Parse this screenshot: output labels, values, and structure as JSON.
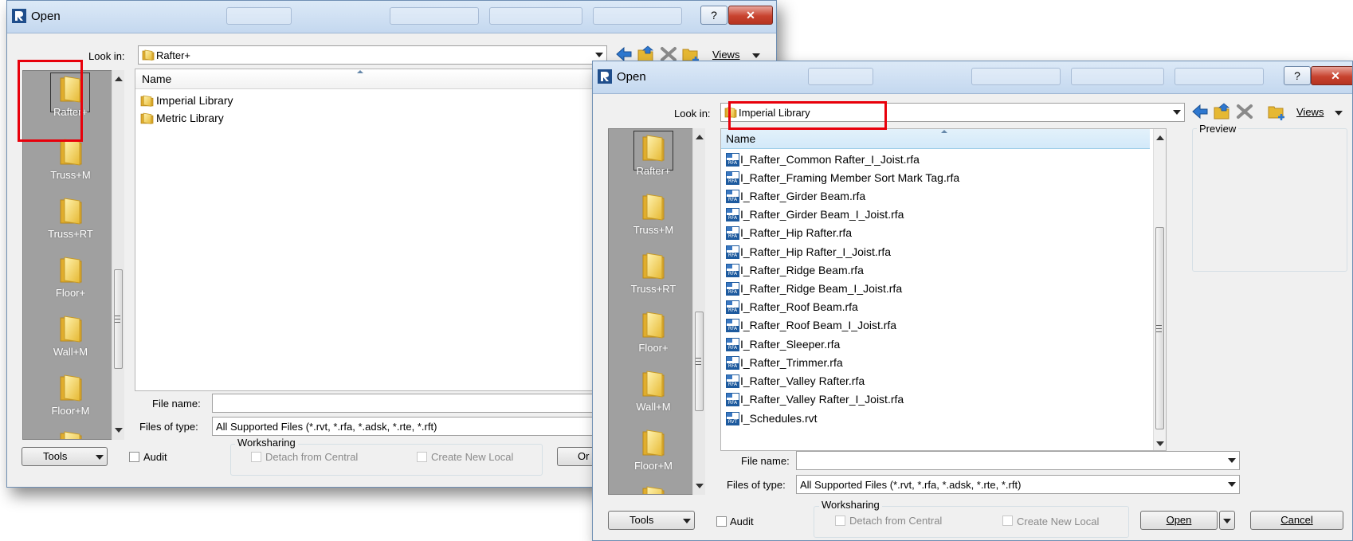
{
  "dialog1": {
    "title": "Open",
    "help_label": "?",
    "close_label": "✕",
    "look_in_label": "Look in:",
    "look_in_value": "Rafter+",
    "views_label": "Views",
    "column_name": "Name",
    "places": [
      "Rafter+",
      "Truss+M",
      "Truss+RT",
      "Floor+",
      "Wall+M",
      "Floor+M"
    ],
    "files": [
      "Imperial Library",
      "Metric Library"
    ],
    "file_name_label": "File name:",
    "file_name_value": "",
    "files_of_type_label": "Files of type:",
    "files_of_type_value": "All Supported Files  (*.rvt, *.rfa, *.adsk, *.rte, *.rft)",
    "tools_label": "Tools",
    "audit_label": "Audit",
    "worksharing_label": "Worksharing",
    "detach_label": "Detach from Central",
    "create_local_label": "Create New Local",
    "open_label_partial": "Or"
  },
  "dialog2": {
    "title": "Open",
    "help_label": "?",
    "close_label": "✕",
    "look_in_label": "Look in:",
    "look_in_value": "Imperial Library",
    "views_label": "Views",
    "column_name": "Name",
    "preview_label": "Preview",
    "places": [
      "Rafter+",
      "Truss+M",
      "Truss+RT",
      "Floor+",
      "Wall+M",
      "Floor+M"
    ],
    "files": [
      {
        "name": "I_Rafter_Common Rafter_I_Joist.rfa",
        "type": "RFA"
      },
      {
        "name": "I_Rafter_Framing Member Sort Mark Tag.rfa",
        "type": "RFA"
      },
      {
        "name": "I_Rafter_Girder Beam.rfa",
        "type": "RFA"
      },
      {
        "name": "I_Rafter_Girder Beam_I_Joist.rfa",
        "type": "RFA"
      },
      {
        "name": "I_Rafter_Hip Rafter.rfa",
        "type": "RFA"
      },
      {
        "name": "I_Rafter_Hip Rafter_I_Joist.rfa",
        "type": "RFA"
      },
      {
        "name": "I_Rafter_Ridge Beam.rfa",
        "type": "RFA"
      },
      {
        "name": "I_Rafter_Ridge Beam_I_Joist.rfa",
        "type": "RFA"
      },
      {
        "name": "I_Rafter_Roof Beam.rfa",
        "type": "RFA"
      },
      {
        "name": "I_Rafter_Roof Beam_I_Joist.rfa",
        "type": "RFA"
      },
      {
        "name": "I_Rafter_Sleeper.rfa",
        "type": "RFA"
      },
      {
        "name": "I_Rafter_Trimmer.rfa",
        "type": "RFA"
      },
      {
        "name": "I_Rafter_Valley Rafter.rfa",
        "type": "RFA"
      },
      {
        "name": "I_Rafter_Valley Rafter_I_Joist.rfa",
        "type": "RFA"
      },
      {
        "name": "I_Schedules.rvt",
        "type": "RVT"
      }
    ],
    "file_name_label": "File name:",
    "file_name_value": "",
    "files_of_type_label": "Files of type:",
    "files_of_type_value": "All Supported Files  (*.rvt, *.rfa, *.adsk, *.rte, *.rft)",
    "tools_label": "Tools",
    "audit_label": "Audit",
    "worksharing_label": "Worksharing",
    "detach_label": "Detach from Central",
    "create_local_label": "Create New Local",
    "open_label": "Open",
    "cancel_label": "Cancel"
  },
  "icons": {
    "app": "revit-app-icon",
    "folder": "folder-icon",
    "back": "back-arrow-icon",
    "up_folder": "up-folder-icon",
    "delete": "delete-x-icon",
    "new_folder": "new-folder-icon",
    "file": "rfa-file-icon"
  },
  "colors": {
    "highlight": "#e8000b",
    "places_bg": "#a0a0a0",
    "title_bar": "#c4d8ef"
  }
}
